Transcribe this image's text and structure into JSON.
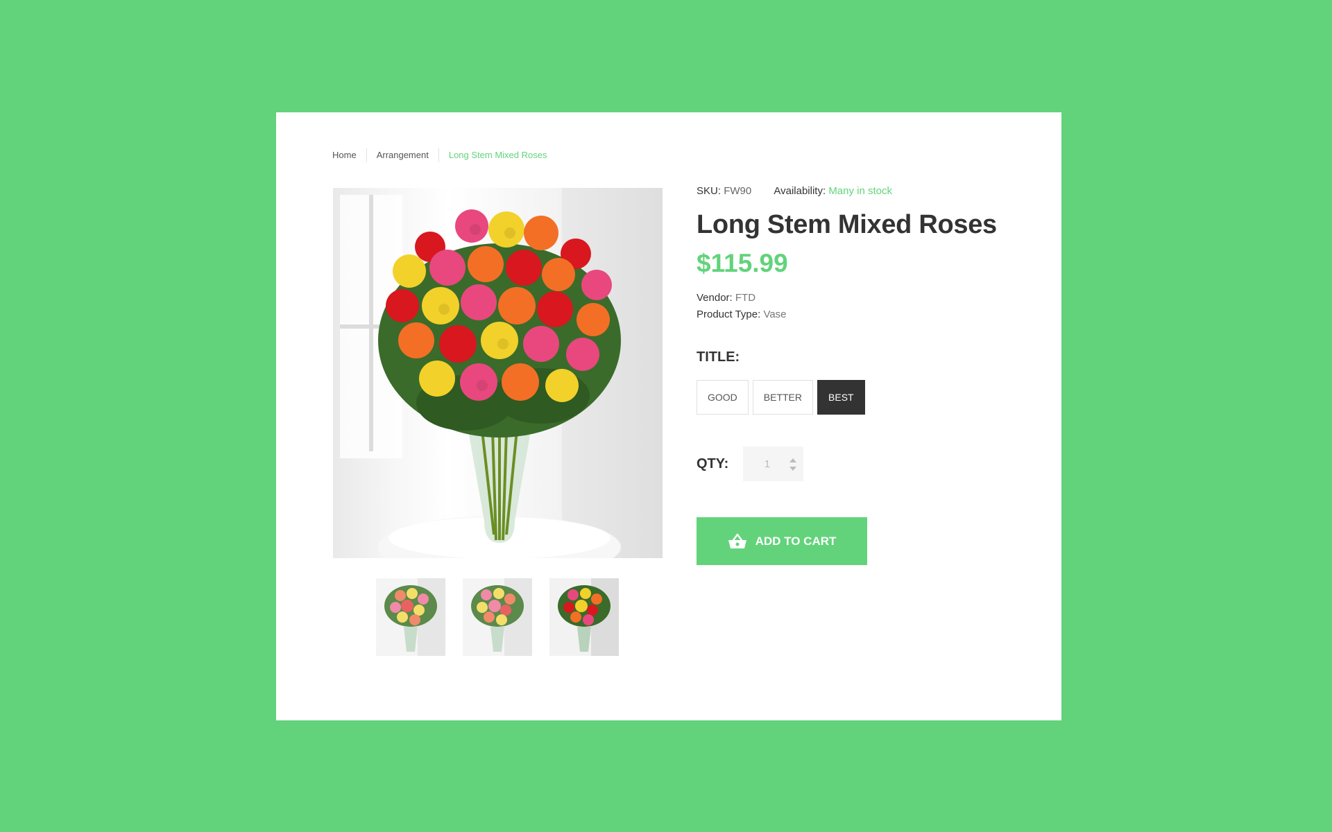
{
  "breadcrumb": {
    "home": "Home",
    "category": "Arrangement",
    "current": "Long Stem Mixed Roses"
  },
  "product": {
    "sku_label": "SKU:",
    "sku": "FW90",
    "availability_label": "Availability:",
    "availability": "Many in stock",
    "title": "Long Stem Mixed Roses",
    "price": "$115.99",
    "vendor_label": "Vendor:",
    "vendor": "FTD",
    "type_label": "Product Type:",
    "type": "Vase"
  },
  "options": {
    "label": "TITLE:",
    "variants": [
      "GOOD",
      "BETTER",
      "BEST"
    ],
    "selected": "BEST"
  },
  "quantity": {
    "label": "QTY:",
    "value": "1"
  },
  "cart": {
    "label": "ADD TO CART",
    "icon": "basket-icon"
  },
  "images": {
    "main": "rose-bouquet-vase-photo",
    "thumbnails": [
      "rose-bouquet-thumb-1",
      "rose-bouquet-thumb-2",
      "rose-bouquet-thumb-3"
    ],
    "selected_thumbnail": 3
  },
  "colors": {
    "background": "#62d37b",
    "accent": "#62d37b",
    "text": "#333333",
    "selected_variant": "#333333"
  }
}
